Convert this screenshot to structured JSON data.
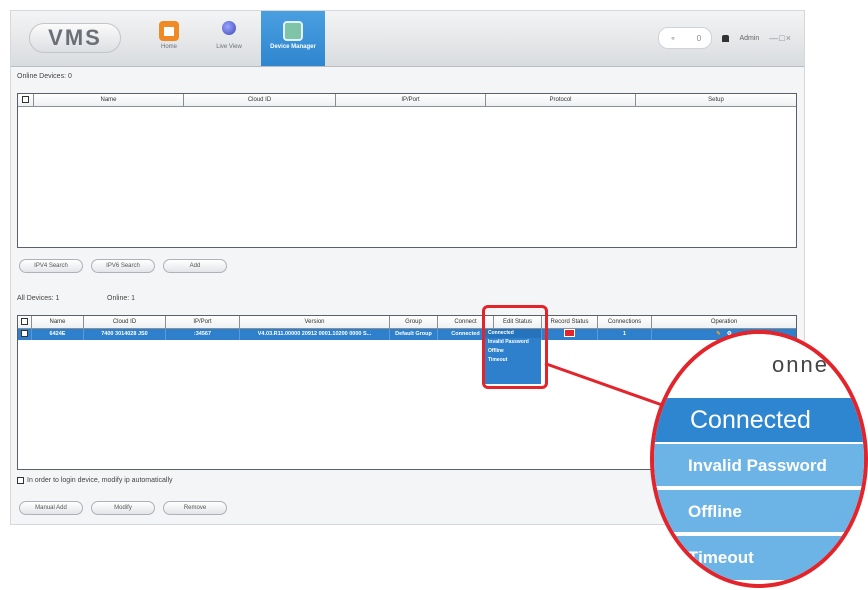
{
  "app": {
    "logo": "VMS"
  },
  "nav": [
    {
      "label": "Home"
    },
    {
      "label": "Live View"
    },
    {
      "label": "Device Manager"
    }
  ],
  "header": {
    "counter": "0",
    "user": "Admin",
    "window_controls": "—□×"
  },
  "online_devices": {
    "label": "Online Devices: 0",
    "columns": [
      "Name",
      "Cloud ID",
      "IP/Port",
      "Protocol",
      "Setup"
    ]
  },
  "search_buttons": [
    "IPV4 Search",
    "IPV6 Search",
    "Add"
  ],
  "all_devices": {
    "label": "All Devices: 1",
    "online_label": "Online: 1",
    "columns": [
      "Name",
      "Cloud ID",
      "IP/Port",
      "Version",
      "Group",
      "Connect",
      "Edit Status",
      "Record Status",
      "Connections",
      "Operation"
    ],
    "row": {
      "name": "6424E",
      "cloud_id": "7400 3014028 JS0",
      "ip_port": ":34567",
      "version": "V4.03.R11.00000 20912 0001.10200 0000 S...",
      "group": "Default Group",
      "connect": "Connected",
      "connections": "1"
    }
  },
  "connect_options": [
    "Connected",
    "Invalid Password",
    "Offline",
    "Timeout"
  ],
  "auto_ip_label": "In order to login device, modify ip automatically",
  "bottom_buttons": [
    "Manual Add",
    "Modify",
    "Remove"
  ],
  "magnifier": {
    "peek_text": "onne",
    "items": [
      "Connected",
      "Invalid Password",
      "Offline",
      "Timeout"
    ]
  },
  "colors": {
    "accent": "#2e7fcc",
    "highlight": "#e3242b",
    "option_bg": "#6cb3e6"
  }
}
